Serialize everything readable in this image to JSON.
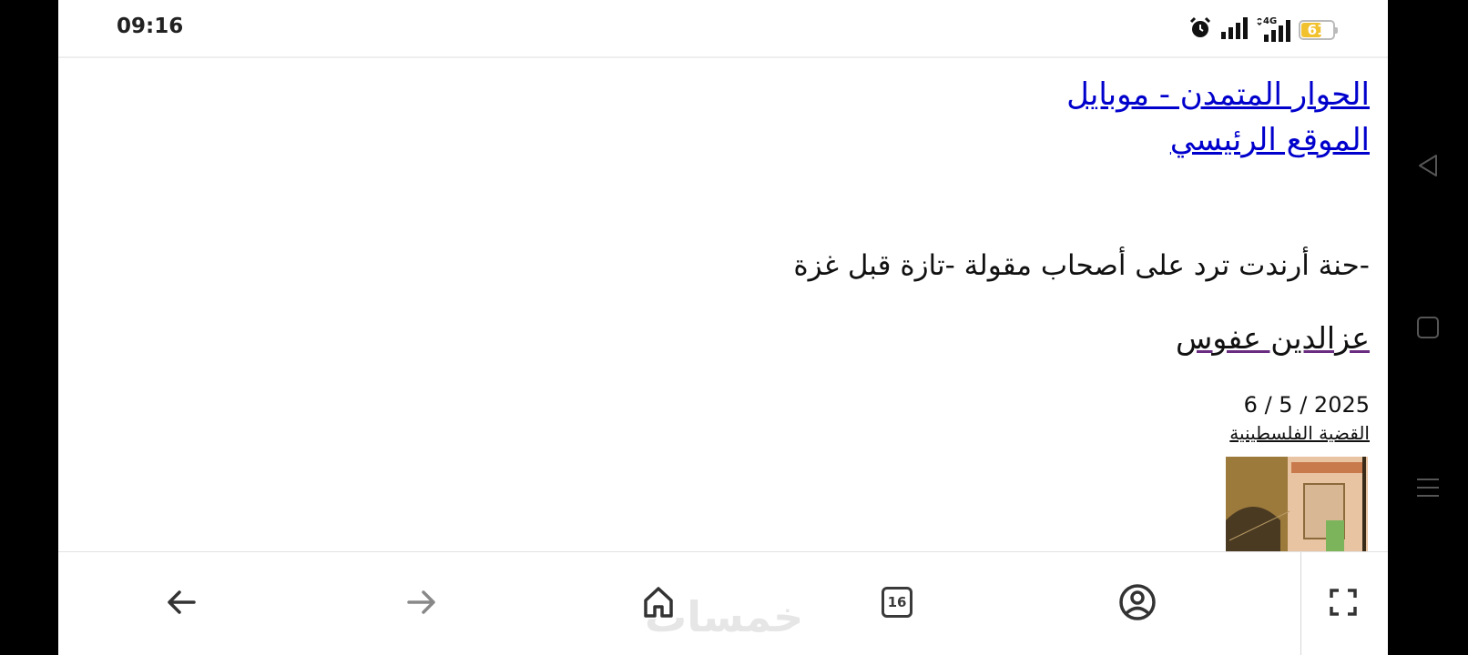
{
  "status_bar": {
    "time": "09:16",
    "icons": [
      "alarm-icon",
      "signal-icon",
      "signal-4g-icon",
      "battery-icon"
    ],
    "network_label": "4G",
    "battery_level": "61",
    "battery_color": "#f2c12e"
  },
  "page": {
    "site_link_1": "الحوار المتمدن - موبايل",
    "site_link_2": "الموقع الرئيسي",
    "article_title": "-حنة أرندت ترد على أصحاب مقولة -تازة قبل غزة",
    "author": "عزالدين عفوس",
    "date": "2025 / 5 / 6",
    "category": "القضية الفلسطينية",
    "link_color": "#0000cc"
  },
  "toolbar": {
    "buttons": [
      "back-icon",
      "forward-icon",
      "home-icon",
      "tabs-icon",
      "account-icon",
      "fullscreen-icon"
    ],
    "tab_count": "16",
    "watermark": "خمسات"
  },
  "system_nav": {
    "buttons": [
      "back-triangle-icon",
      "home-square-icon",
      "menu-icon"
    ]
  }
}
